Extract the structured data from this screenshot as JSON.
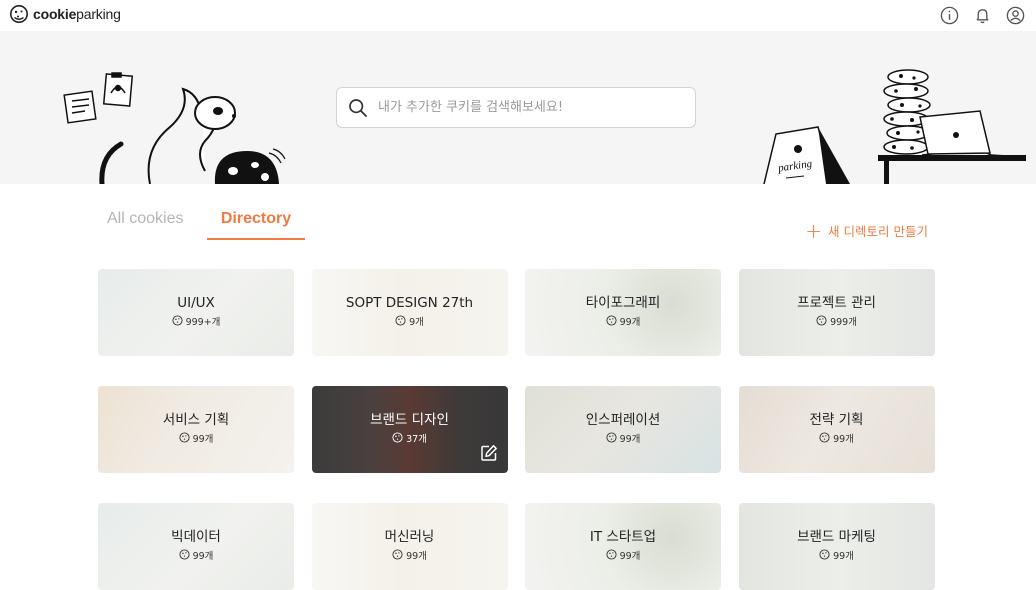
{
  "app": {
    "logo_bold": "cookie",
    "logo_light": "parking"
  },
  "header_icons": [
    "info-icon",
    "bell-icon",
    "user-icon"
  ],
  "search": {
    "placeholder": "내가 추가한 쿠키를 검색해보세요!"
  },
  "hero_art": {
    "sign_text": "parking"
  },
  "tabs": [
    {
      "label": "All cookies",
      "active": false
    },
    {
      "label": "Directory",
      "active": true
    }
  ],
  "new_directory_label": "새 디렉토리 만들기",
  "accent_color": "#f07a40",
  "directories": [
    {
      "title": "UI/UX",
      "count": "999+개"
    },
    {
      "title": "SOPT DESIGN 27th",
      "count": "9개"
    },
    {
      "title": "타이포그래피",
      "count": "99개"
    },
    {
      "title": "프로젝트 관리",
      "count": "999개"
    },
    {
      "title": "서비스 기획",
      "count": "99개"
    },
    {
      "title": "브랜드 디자인",
      "count": "37개",
      "selected": true
    },
    {
      "title": "인스퍼레이션",
      "count": "99개"
    },
    {
      "title": "전략 기획",
      "count": "99개"
    },
    {
      "title": "빅데이터",
      "count": "99개"
    },
    {
      "title": "머신러닝",
      "count": "99개"
    },
    {
      "title": "IT 스타트업",
      "count": "99개"
    },
    {
      "title": "브랜드 마케팅",
      "count": "99개"
    }
  ]
}
